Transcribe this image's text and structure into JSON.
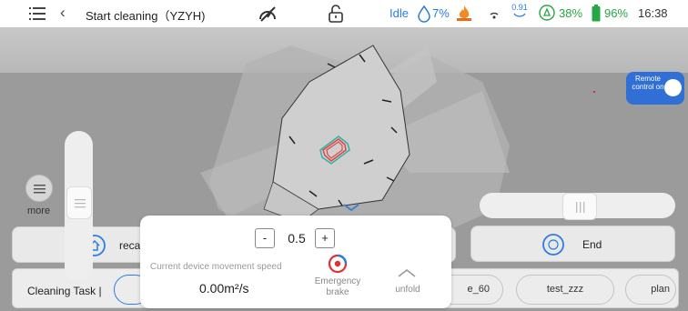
{
  "header": {
    "title": "Start cleaning（YZYH)",
    "status": "Idle",
    "water_level": "7%",
    "signal_value": "0.91",
    "recycle_level": "38%",
    "battery_level": "96%",
    "time": "16:38",
    "icons": [
      "menu-icon",
      "back-icon",
      "speedometer-off-icon",
      "unlock-icon",
      "water-drop-icon",
      "fire-icon",
      "wifi-icon",
      "signal-icon",
      "recycle-icon",
      "battery-icon"
    ]
  },
  "map": {
    "remote_control_label": "Remote control on",
    "remote_control_on": true,
    "more_label": "more"
  },
  "actions": {
    "recall_label": "reca",
    "end_label": "End"
  },
  "tasks": {
    "title": "Cleaning Task |",
    "items": [
      "e_60",
      "test_zzz",
      "plan"
    ]
  },
  "speed_panel": {
    "decrement_label": "-",
    "increment_label": "+",
    "speed_setting": "0.5",
    "caption": "Current device movement speed",
    "current_speed": "0.00m²/s",
    "brake_label": "Emergency brake",
    "unfold_label": "unfold"
  },
  "colors": {
    "accent": "#2b7de0",
    "green": "#27a744",
    "brake_red": "#e03030"
  }
}
